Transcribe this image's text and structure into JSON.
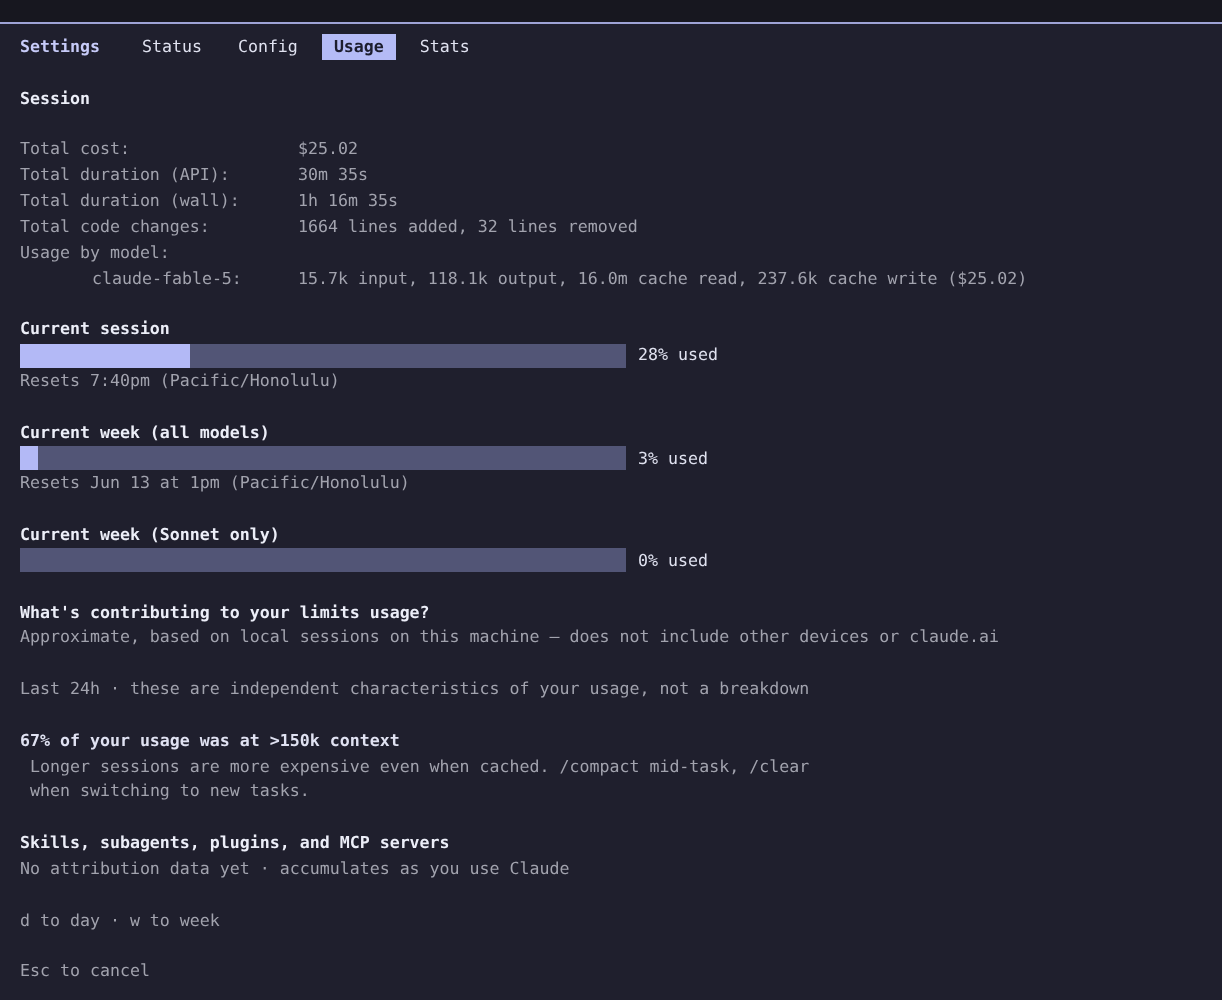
{
  "header": {
    "title": "Settings"
  },
  "tabs": [
    {
      "label": "Status",
      "selected": false
    },
    {
      "label": "Config",
      "selected": false
    },
    {
      "label": "Usage",
      "selected": true
    },
    {
      "label": "Stats",
      "selected": false
    }
  ],
  "session": {
    "heading": "Session",
    "stats": [
      {
        "label": "Total cost:",
        "value": "$25.02"
      },
      {
        "label": "Total duration (API):",
        "value": "30m 35s"
      },
      {
        "label": "Total duration (wall):",
        "value": "1h 16m 35s"
      },
      {
        "label": "Total code changes:",
        "value": "1664 lines added, 32 lines removed"
      }
    ],
    "model_usage": {
      "label": "Usage by model:",
      "models": [
        {
          "name": "claude-fable-5:",
          "usage": "15.7k input, 118.1k output, 16.0m cache read, 237.6k cache write ($25.02)"
        }
      ]
    }
  },
  "limits": [
    {
      "heading": "Current session",
      "level": 0.28,
      "reading": "28% used",
      "reset": "Resets 7:40pm (Pacific/Honolulu)"
    },
    {
      "heading": "Current week (all models)",
      "level": 0.03,
      "reading": "3% used",
      "reset": "Resets Jun 13 at 1pm (Pacific/Honolulu)"
    },
    {
      "heading": "Current week (Sonnet only)",
      "level": 0,
      "reading": "0% used"
    }
  ],
  "contributing": {
    "heading": "What's contributing to your limits usage?",
    "subtitle": "Approximate, based on local sessions on this machine — does not include other devices or claude.ai",
    "period": "Last 24h · these are independent characteristics of your usage, not a breakdown",
    "insights": [
      {
        "heading": "67% of your usage was at >150k context",
        "detail_lines": [
          "Longer sessions are more expensive even when cached. /compact mid-task, /clear",
          "when switching to new tasks."
        ]
      }
    ]
  },
  "attribution": {
    "heading": "Skills, subagents, plugins, and MCP servers",
    "text": "No attribution data yet · accumulates as you use Claude"
  },
  "hints": [
    "d to day · w to week",
    "Esc to cancel"
  ]
}
